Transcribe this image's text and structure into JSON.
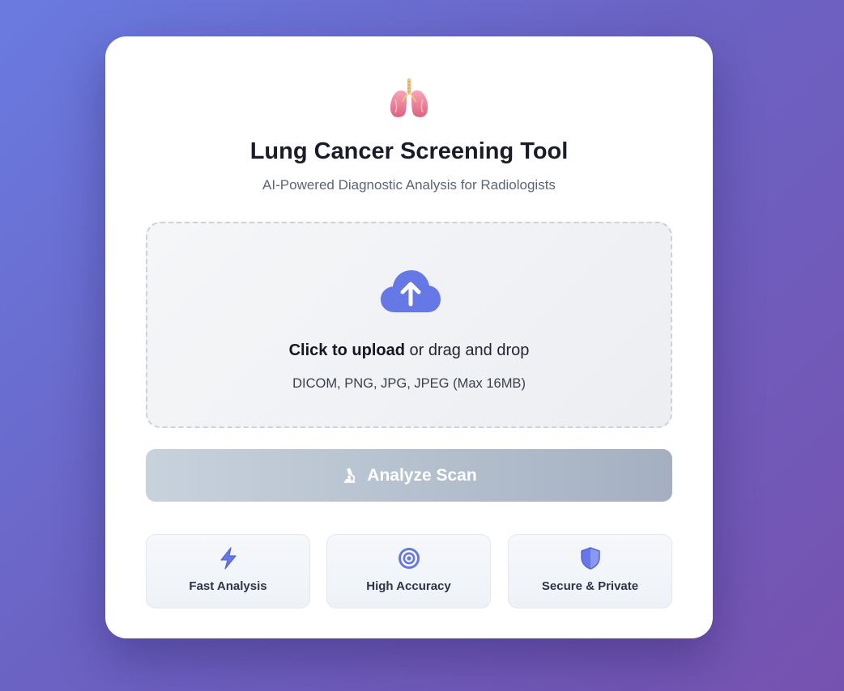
{
  "header": {
    "logo_icon": "lungs-icon",
    "title": "Lung Cancer Screening Tool",
    "subtitle": "AI-Powered Diagnostic Analysis for Radiologists"
  },
  "upload": {
    "icon": "cloud-upload-icon",
    "action_label": "Click to upload",
    "action_suffix": " or drag and drop",
    "formats": "DICOM, PNG, JPG, JPEG (Max 16MB)"
  },
  "analyze_button": {
    "icon": "microscope-icon",
    "label": "Analyze Scan",
    "state": "disabled"
  },
  "features": [
    {
      "icon": "lightning-icon",
      "label": "Fast Analysis"
    },
    {
      "icon": "target-icon",
      "label": "High Accuracy"
    },
    {
      "icon": "shield-icon",
      "label": "Secure & Private"
    }
  ],
  "colors": {
    "accent": "#6678e6",
    "background_start": "#6a7be0",
    "background_end": "#7652b0",
    "title": "#1a1d29",
    "button_disabled_start": "#c8d2dd",
    "button_disabled_end": "#a4b0c1"
  }
}
